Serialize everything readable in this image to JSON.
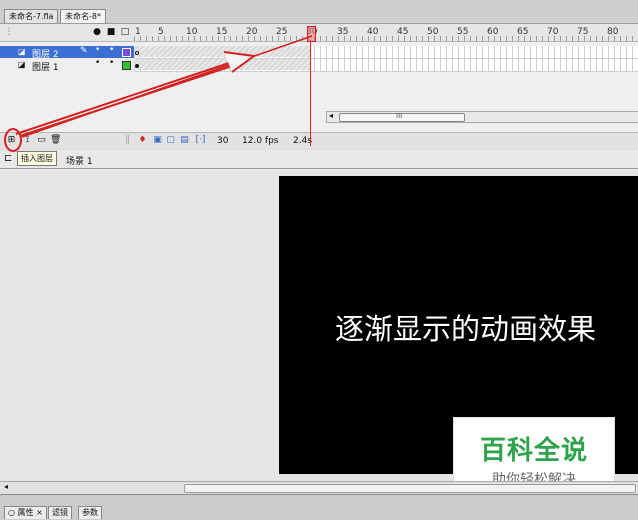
{
  "doc_tabs": [
    "未命名-7.fla",
    "未命名-8*"
  ],
  "ruler_numbers": [
    "1",
    "5",
    "10",
    "15",
    "20",
    "25",
    "30",
    "35",
    "40",
    "45",
    "50",
    "55",
    "60",
    "65",
    "70",
    "75",
    "80"
  ],
  "layers": [
    {
      "name": "图层 2",
      "selected": true,
      "color": "#7a4ee0"
    },
    {
      "name": "图层 1",
      "selected": false,
      "color": "#34c234"
    }
  ],
  "timeline_status": {
    "frame": "30",
    "fps": "12.0 fps",
    "time": "2.4s",
    "scroll_grip": "III"
  },
  "tooltip": "插入图层",
  "scene": "场景 1",
  "stage_text": "逐渐显示的动画效果",
  "watermark": {
    "title": "百科全说",
    "subtitle": "助你轻松解决"
  },
  "panel_tabs": [
    "○ 属性 ×",
    "滤镜",
    "参数"
  ],
  "colors": {
    "selection": "#3b6fd6",
    "playhead": "#e02020",
    "annotation": "#d42020",
    "watermark_green": "#2da34a"
  }
}
